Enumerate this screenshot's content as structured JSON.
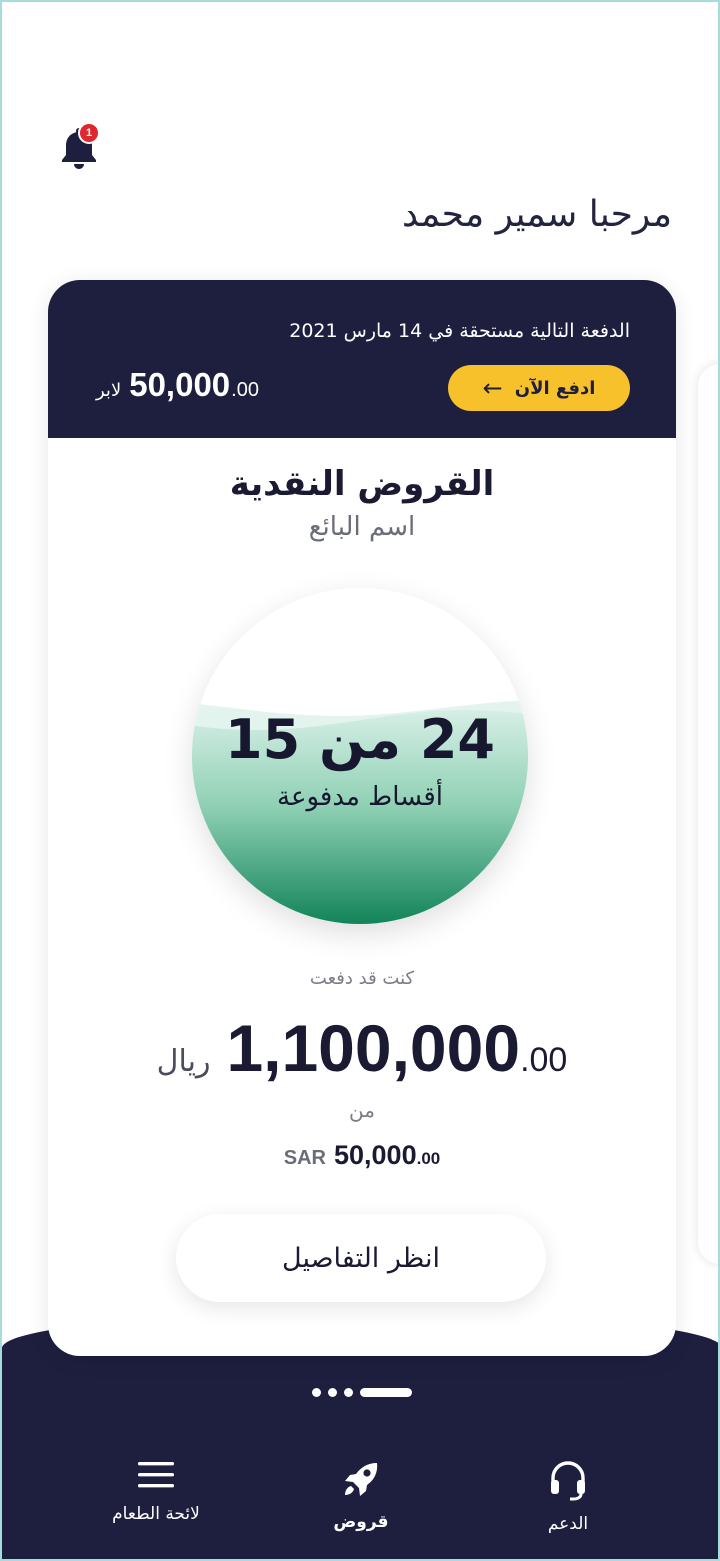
{
  "notifications": {
    "count": "1"
  },
  "greeting": "مرحبا سمير محمد",
  "payment_banner": {
    "due_text": "الدفعة التالية مستحقة في 14 مارس 2021",
    "pay_now_label": "ادفع الآن",
    "amount_whole": "50,000",
    "amount_decimal": ".00",
    "currency": "لابر"
  },
  "loan": {
    "title": "القروض النقدية",
    "vendor": "اسم البائع",
    "installments": {
      "count_text": "24 من 15",
      "label": "أقساط مدفوعة",
      "paid": 15,
      "total": 24
    },
    "paid_label": "كنت قد دفعت",
    "paid_amount_whole": "1,100,000",
    "paid_amount_decimal": ".00",
    "paid_currency": "ريال",
    "of_label": "من",
    "total_currency": "SAR",
    "total_amount_whole": "50,000",
    "total_amount_decimal": ".00",
    "details_button": "انظر التفاصيل"
  },
  "pager": {
    "pages": 4,
    "active": 0
  },
  "bottom_nav": {
    "support": {
      "label": "الدعم",
      "icon": "headset-icon"
    },
    "loans": {
      "label": "قروض",
      "icon": "rocket-icon"
    },
    "menu": {
      "label": "لائحة الطعام",
      "icon": "hamburger-menu-icon"
    }
  },
  "colors": {
    "navy": "#1e1f3f",
    "accent_yellow": "#f6c12b",
    "progress_green": "#12845a",
    "badge_red": "#e2262d"
  }
}
